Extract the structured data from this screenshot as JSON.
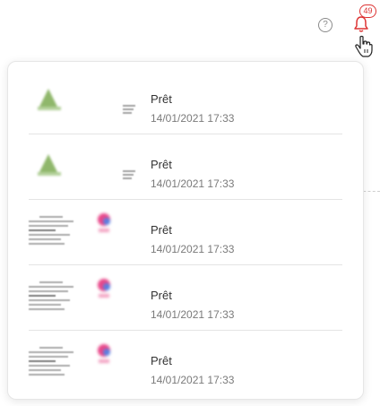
{
  "header": {
    "help_icon": "help-circle-icon",
    "help_glyph": "?",
    "bell_icon": "bell-icon",
    "notification_count": "49",
    "accent": "#d33333"
  },
  "notifications": [
    {
      "status": "Prêt",
      "timestamp": "14/01/2021 17:33",
      "thumbnail": "green-logo-document"
    },
    {
      "status": "Prêt",
      "timestamp": "14/01/2021 17:33",
      "thumbnail": "green-logo-document"
    },
    {
      "status": "Prêt",
      "timestamp": "14/01/2021 17:33",
      "thumbnail": "receipt-document"
    },
    {
      "status": "Prêt",
      "timestamp": "14/01/2021 17:33",
      "thumbnail": "receipt-document"
    },
    {
      "status": "Prêt",
      "timestamp": "14/01/2021 17:33",
      "thumbnail": "receipt-document"
    }
  ]
}
